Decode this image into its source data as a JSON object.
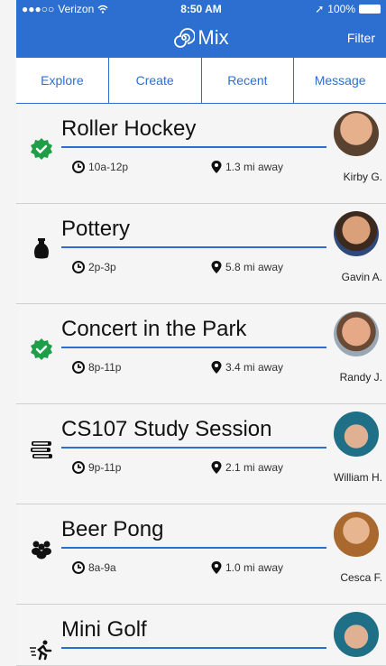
{
  "status_bar": {
    "carrier": "Verizon",
    "time": "8:50 AM",
    "battery": "100%"
  },
  "header": {
    "app_name": "Mix",
    "filter_label": "Filter"
  },
  "tabs": [
    {
      "label": "Explore"
    },
    {
      "label": "Create"
    },
    {
      "label": "Recent"
    },
    {
      "label": "Message"
    }
  ],
  "colors": {
    "accent": "#2d6fd0",
    "check_green": "#1e9e46"
  },
  "items": [
    {
      "title": "Roller Hockey",
      "time": "10a-12p",
      "distance": "1.3 mi away",
      "user": "Kirby G.",
      "icon": "check-badge-icon",
      "avatar_color": "#c98f6c"
    },
    {
      "title": "Pottery",
      "time": "2p-3p",
      "distance": "5.8 mi away",
      "user": "Gavin A.",
      "icon": "vase-icon",
      "avatar_color": "#6b4b2b"
    },
    {
      "title": "Concert in the Park",
      "time": "8p-11p",
      "distance": "3.4 mi away",
      "user": "Randy J.",
      "icon": "check-badge-icon",
      "avatar_color": "#c98f6c"
    },
    {
      "title": "CS107 Study Session",
      "time": "9p-11p",
      "distance": "2.1 mi away",
      "user": "William H.",
      "icon": "books-icon",
      "avatar_color": "#2a5b6a"
    },
    {
      "title": "Beer Pong",
      "time": "8a-9a",
      "distance": "1.0 mi away",
      "user": "Cesca F.",
      "icon": "people-group-icon",
      "avatar_color": "#c78a4a"
    },
    {
      "title": "Mini Golf",
      "time": "",
      "distance": "",
      "user": "",
      "icon": "runner-icon",
      "avatar_color": "#2a5b6a"
    }
  ]
}
